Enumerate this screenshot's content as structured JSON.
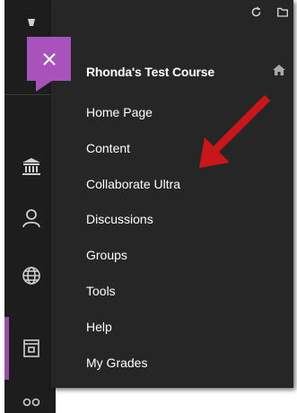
{
  "course": {
    "title": "Rhonda's Test Course"
  },
  "menu": {
    "items": [
      {
        "label": "Home Page"
      },
      {
        "label": "Content"
      },
      {
        "label": "Collaborate Ultra"
      },
      {
        "label": "Discussions"
      },
      {
        "label": "Groups"
      },
      {
        "label": "Tools"
      },
      {
        "label": "Help"
      },
      {
        "label": "My Grades"
      }
    ]
  },
  "colors": {
    "accent": "#a853bc",
    "rail_background": "#1d1d1d",
    "panel_background": "#262626",
    "annotation_arrow": "#c8161b"
  },
  "icons": [
    "close-icon",
    "refresh-icon",
    "folder-icon",
    "home-icon",
    "institution-icon",
    "profile-icon",
    "globe-icon",
    "courses-icon",
    "groups-icon"
  ]
}
